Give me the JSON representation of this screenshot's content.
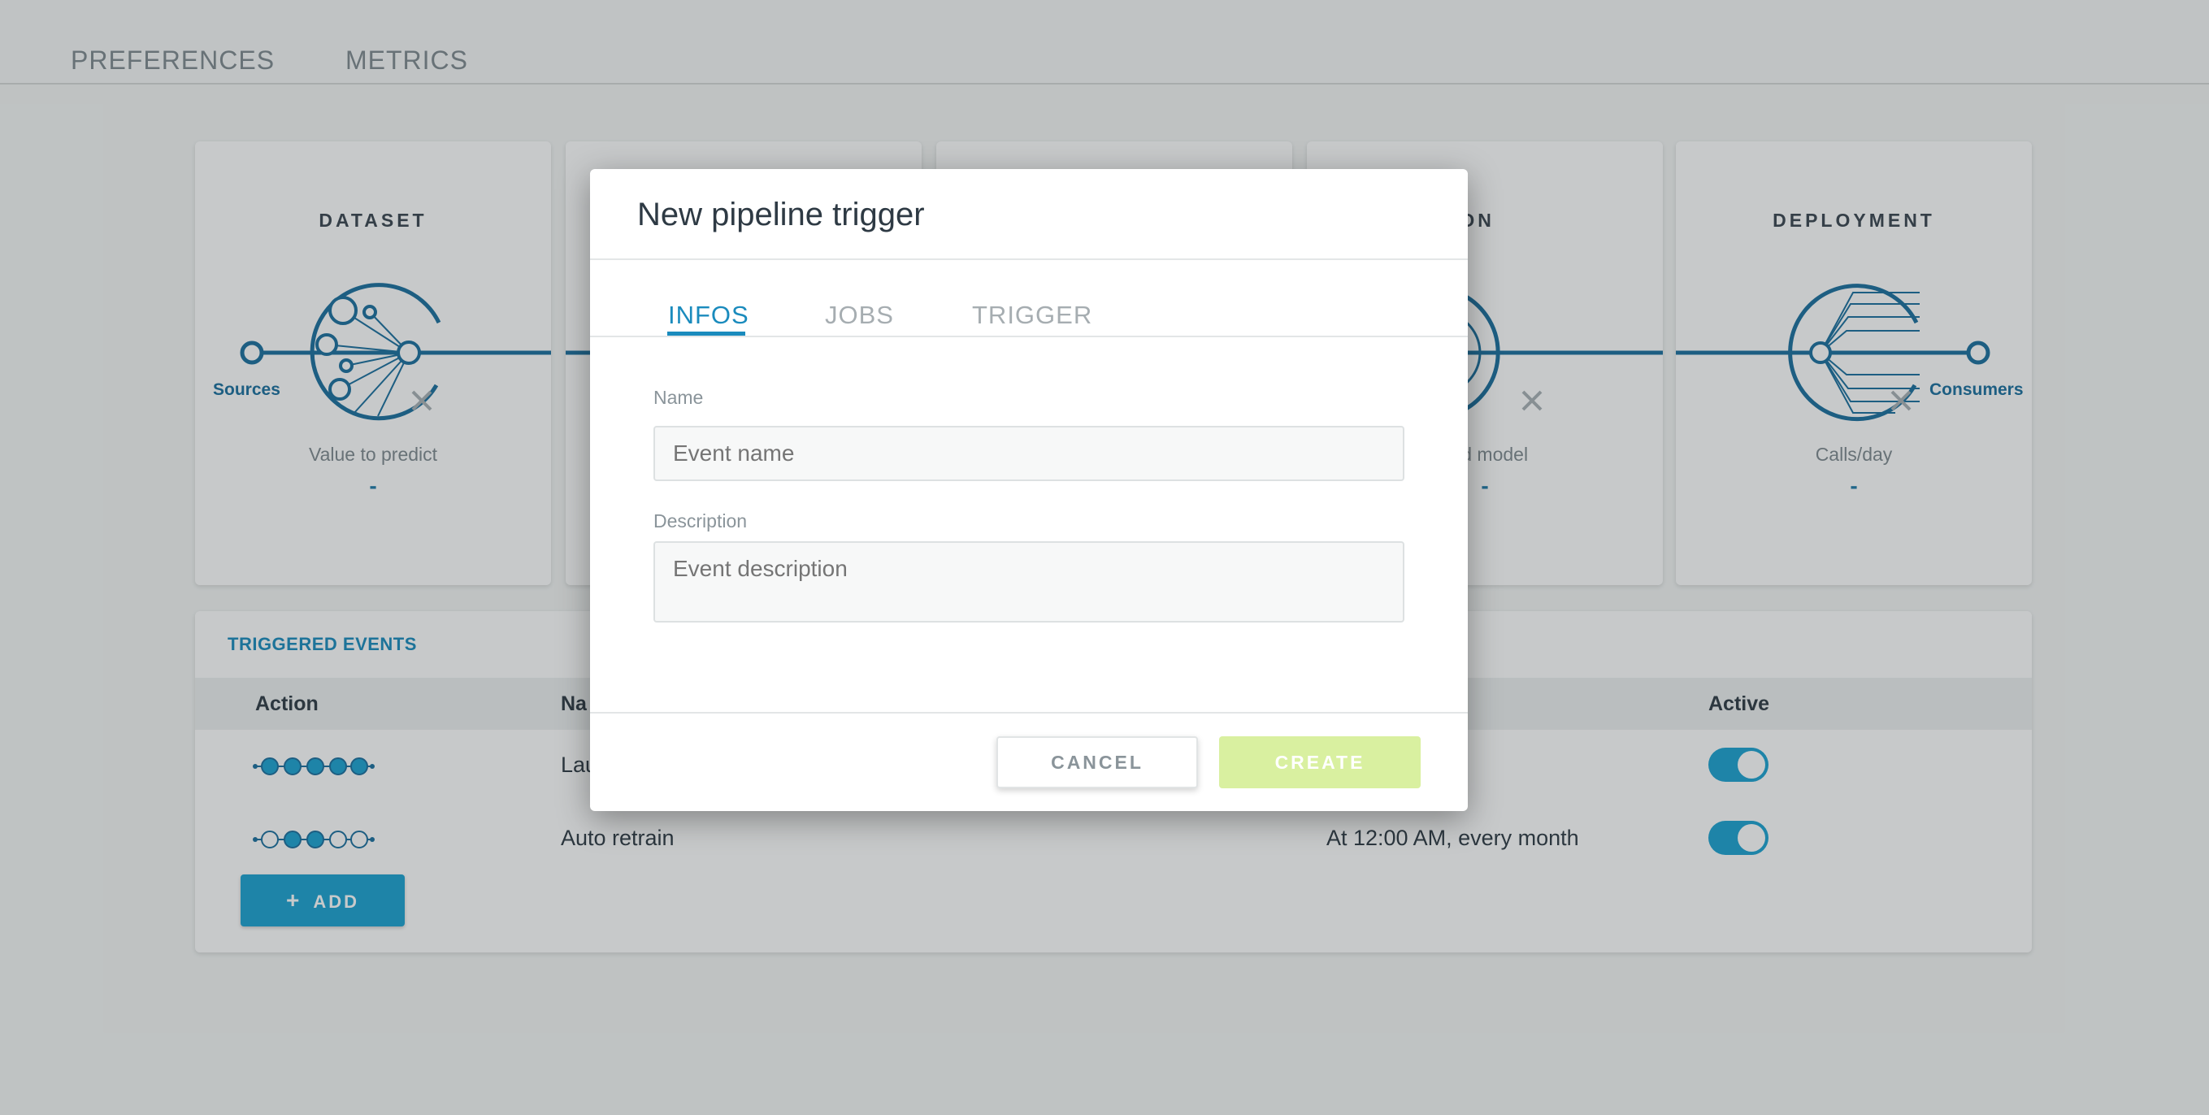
{
  "nav": {
    "items": [
      "PREFERENCES",
      "METRICS"
    ]
  },
  "cards": {
    "dataset": {
      "title": "DATASET",
      "metric_label": "Value to predict",
      "metric_value": "-",
      "left_label": "Sources"
    },
    "selection": {
      "title": "ECTION",
      "metric_label": "ved model",
      "metric_value": "-"
    },
    "deployment": {
      "title": "DEPLOYMENT",
      "metric_label": "Calls/day",
      "metric_value": "-",
      "right_label": "Consumers"
    }
  },
  "events": {
    "title": "TRIGGERED EVENTS",
    "columns": {
      "action": "Action",
      "name": "Na",
      "active": "Active"
    },
    "rows": [
      {
        "name": "Lau",
        "schedule": "",
        "active": true
      },
      {
        "name": "Auto retrain",
        "schedule": "At 12:00 AM, every month",
        "active": true
      }
    ],
    "add_label": "ADD",
    "add_icon": "plus-icon"
  },
  "modal": {
    "title": "New pipeline trigger",
    "tabs": [
      "INFOS",
      "JOBS",
      "TRIGGER"
    ],
    "active_tab": "INFOS",
    "name_label": "Name",
    "name_placeholder": "Event name",
    "name_value": "",
    "description_label": "Description",
    "description_placeholder": "Event description",
    "description_value": "",
    "cancel_label": "CANCEL",
    "create_label": "CREATE"
  },
  "colors": {
    "accent": "#1a8bbd",
    "primary_button": "#1ba3d1",
    "disabled_create": "#d9f0a0"
  }
}
